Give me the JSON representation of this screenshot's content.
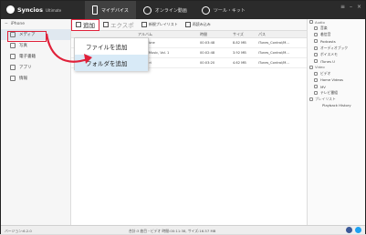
{
  "app": {
    "name": "Syncios",
    "edition": "Ultimate"
  },
  "nav": [
    {
      "label": "マイデバイス",
      "active": true
    },
    {
      "label": "オンライン動画",
      "active": false
    },
    {
      "label": "ツール・キット",
      "active": false
    }
  ],
  "sidebar": {
    "device": "iPhone",
    "items": [
      {
        "label": "メディア",
        "selected": true
      },
      {
        "label": "写真",
        "selected": false
      },
      {
        "label": "電子書籍",
        "selected": false
      },
      {
        "label": "アプリ",
        "selected": false
      },
      {
        "label": "情報",
        "selected": false
      }
    ]
  },
  "toolbar": {
    "add_label": "追加",
    "export_label": "エクスポ",
    "new_playlist_label": "新規プレイリスト",
    "reload_label": "再読み込み"
  },
  "dropdown": {
    "items": [
      {
        "label": "ファイルを追加"
      },
      {
        "label": "フォルダを追加"
      }
    ]
  },
  "table": {
    "columns": [
      "",
      "アルバム",
      "時間",
      "サイズ",
      "パス"
    ],
    "rows": [
      {
        "title": "",
        "album": "Ninja Tune",
        "time": "00:03:48",
        "size": "8.82 MB",
        "path": "iTunes_Control/M..."
      },
      {
        "title": "",
        "album": "...Fine Music, Vol. 1",
        "time": "00:02:48",
        "size": "3.92 MB",
        "path": "iTunes_Control/M..."
      },
      {
        "title": "",
        "album": "Bob Acri",
        "time": "00:03:20",
        "size": "4.62 MB",
        "path": "iTunes_Control/M..."
      }
    ]
  },
  "right_panel": {
    "audio_label": "Audio",
    "audio_items": [
      "音楽",
      "着信音",
      "Podcasts",
      "オーディオブック",
      "ボイスメモ",
      "iTunes U"
    ],
    "video_label": "Video",
    "video_items": [
      "ビデオ",
      "Home Videos",
      "MV",
      "テレビ番組"
    ],
    "playlist_label": "プレイリスト",
    "playlist_items": [
      "Playback History"
    ]
  },
  "status": {
    "version": "バージョン:6.2.0",
    "summary": "合計:3 曲目・ビデオ 時間:00:11:38, サイズ:16.57 MB"
  },
  "colors": {
    "highlight": "#e0213a",
    "topbar": "#2b2b2b",
    "twitter": "#1da1f2",
    "facebook": "#3b5998"
  }
}
